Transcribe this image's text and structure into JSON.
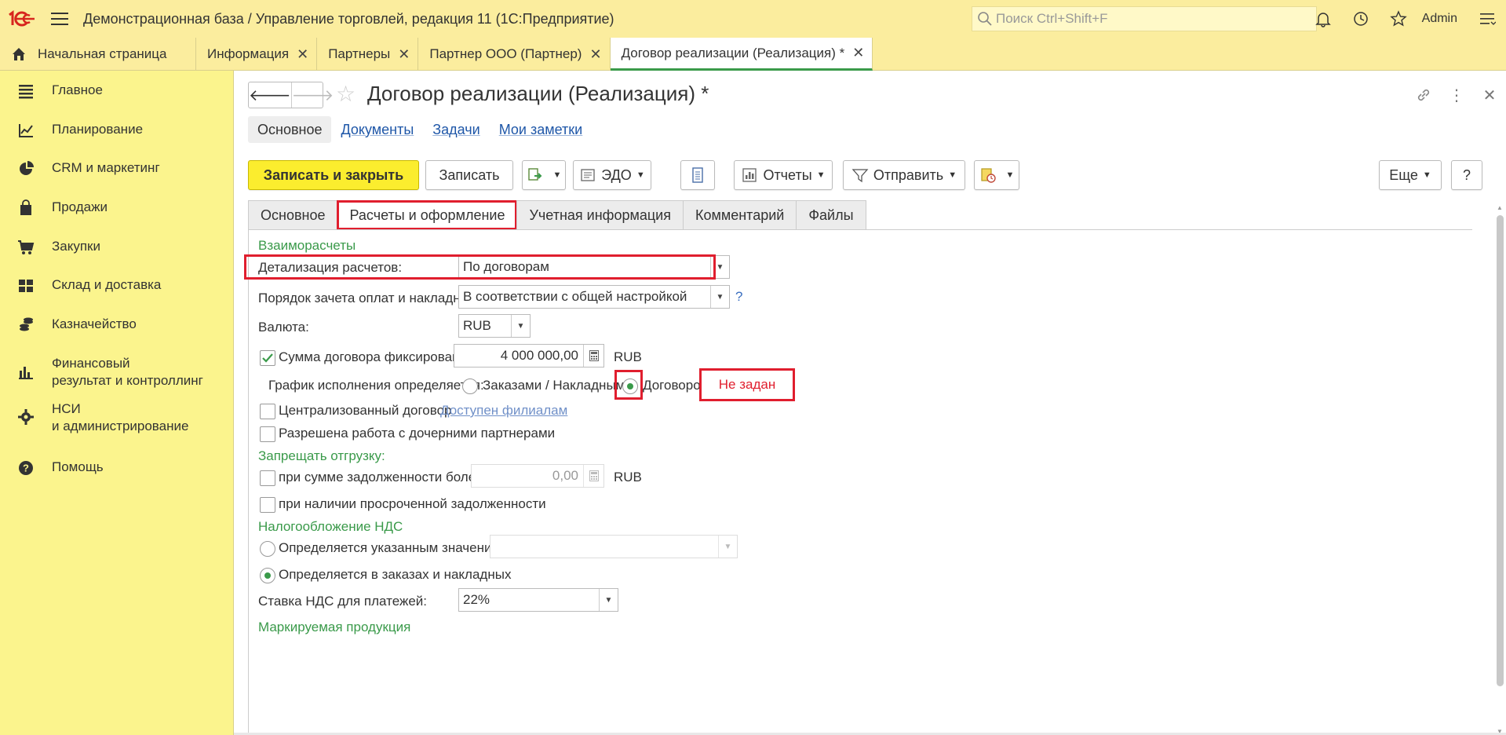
{
  "app": {
    "title": "Демонстрационная база / Управление торговлей, редакция 11  (1С:Предприятие)",
    "search_placeholder": "Поиск Ctrl+Shift+F",
    "user": "Admin"
  },
  "tabs": {
    "home": "Начальная страница",
    "items": [
      {
        "label": "Информация"
      },
      {
        "label": "Партнеры"
      },
      {
        "label": "Партнер ООО (Партнер)"
      },
      {
        "label": "Договор реализации (Реализация) *"
      }
    ]
  },
  "sidebar": {
    "items": [
      {
        "label": "Главное",
        "icon": "menu-lines-icon"
      },
      {
        "label": "Планирование",
        "icon": "chart-trend-icon"
      },
      {
        "label": "CRM и маркетинг",
        "icon": "pie-chart-icon"
      },
      {
        "label": "Продажи",
        "icon": "shopping-bag-icon"
      },
      {
        "label": "Закупки",
        "icon": "cart-icon"
      },
      {
        "label": "Склад и доставка",
        "icon": "warehouse-grid-icon"
      },
      {
        "label": "Казначейство",
        "icon": "coins-icon"
      },
      {
        "label": "Финансовый",
        "label2": "результат и контроллинг",
        "icon": "bar-chart-icon"
      },
      {
        "label": "НСИ",
        "label2": "и администрирование",
        "icon": "gear-icon"
      },
      {
        "label": "Помощь",
        "icon": "help-circle-icon"
      }
    ]
  },
  "document": {
    "title": "Договор реализации (Реализация) *",
    "sections": [
      "Основное",
      "Документы",
      "Задачи",
      "Мои заметки"
    ]
  },
  "toolbar": {
    "save_close": "Записать и закрыть",
    "save": "Записать",
    "edo": "ЭДО",
    "reports": "Отчеты",
    "send": "Отправить",
    "more": "Еще",
    "help": "?"
  },
  "form_tabs": [
    "Основное",
    "Расчеты и оформление",
    "Учетная информация",
    "Комментарий",
    "Файлы"
  ],
  "form": {
    "group_settlements": "Взаиморасчеты",
    "detail_label": "Детализация расчетов:",
    "detail_value": "По договорам",
    "offset_label": "Порядок зачета оплат и накладных:",
    "offset_value": "В соответствии с общей настройкой",
    "offset_help": "?",
    "currency_label": "Валюта:",
    "currency_value": "RUB",
    "fixed_sum_label": "Сумма договора фиксирована",
    "fixed_sum_value": "4 000 000,00",
    "fixed_sum_currency": "RUB",
    "schedule_label": "График исполнения определяется:",
    "schedule_opt1": "Заказами / Накладными",
    "schedule_opt2": "Договором",
    "schedule_status": "Не задан",
    "centralized_label": "Централизованный договор",
    "branches_link": "Доступен филиалам",
    "subsidiary_label": "Разрешена работа с дочерними партнерами",
    "group_block": "Запрещать отгрузку:",
    "debt_label": "при сумме задолженности более:",
    "debt_value": "0,00",
    "debt_currency": "RUB",
    "overdue_label": "при наличии просроченной задолженности",
    "group_vat": "Налогообложение НДС",
    "vat_opt1": "Определяется указанным значением",
    "vat_opt2": "Определяется в заказах и накладных",
    "vat_rate_label": "Ставка НДС для платежей:",
    "vat_rate_value": "22%",
    "group_marked": "Маркируемая продукция"
  },
  "colors": {
    "accent_yellow": "#fbed2e",
    "sidebar_bg": "#fbf48d",
    "group_green": "#3a9a4a",
    "highlight_red": "#e01e2e"
  }
}
